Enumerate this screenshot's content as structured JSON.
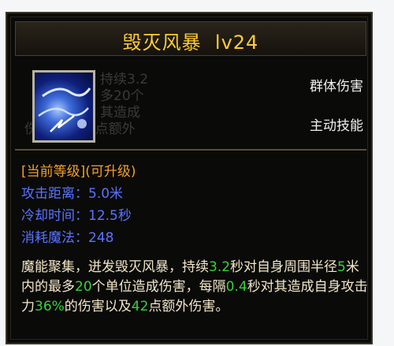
{
  "skill": {
    "name_level": "毁灭风暴  lv24",
    "tags": [
      "群体伤害",
      "主动技能"
    ],
    "level_status": "[当前等级](可升级)",
    "stats": [
      {
        "label": "攻击距离：",
        "value": "5.0米"
      },
      {
        "label": "冷却时间：",
        "value": "12.5秒"
      },
      {
        "label": "消耗魔法：",
        "value": "248"
      }
    ],
    "description": [
      {
        "text": "魔能聚集，迸发毁灭风暴，持续",
        "hl": false
      },
      {
        "text": "3.2",
        "hl": true
      },
      {
        "text": "秒对自身周围半径",
        "hl": false
      },
      {
        "text": "5",
        "hl": true
      },
      {
        "text": "米内的最多",
        "hl": false
      },
      {
        "text": "20",
        "hl": true
      },
      {
        "text": "个单位造成伤害，每隔",
        "hl": false
      },
      {
        "text": "0.4",
        "hl": true
      },
      {
        "text": "秒对其造成自身攻击力",
        "hl": false
      },
      {
        "text": "36%",
        "hl": true
      },
      {
        "text": "的伤害以及",
        "hl": false
      },
      {
        "text": "42",
        "hl": true
      },
      {
        "text": "点额外伤害。",
        "hl": false
      }
    ],
    "ghost_text": [
      {
        "text": "持续3.2"
      },
      {
        "text": "多20个"
      },
      {
        "text": "其造成"
      },
      {
        "text": "伤害以及42点额外"
      }
    ]
  }
}
